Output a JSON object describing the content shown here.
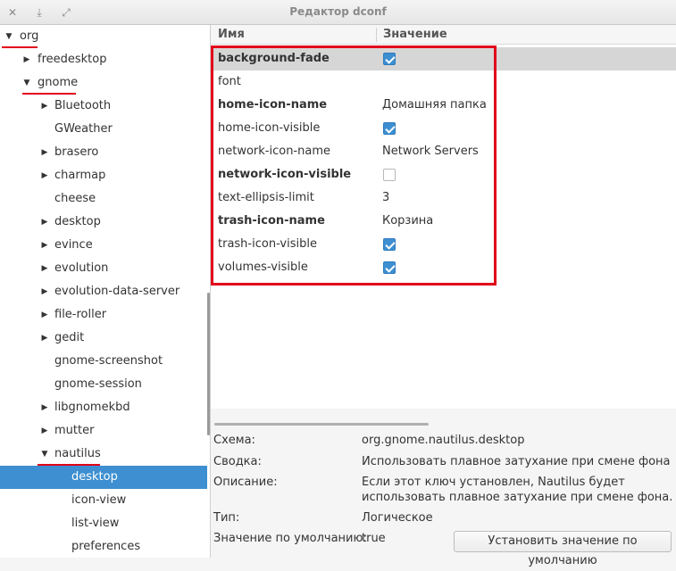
{
  "window": {
    "title": "Редактор dconf",
    "close_glyph": "✕",
    "minimize_glyph": "⤓",
    "maximize_glyph": "⤢"
  },
  "tree": [
    {
      "label": "org",
      "level": 0,
      "expanded": true,
      "has_arrow": true
    },
    {
      "label": "freedesktop",
      "level": 1,
      "expanded": false,
      "has_arrow": true
    },
    {
      "label": "gnome",
      "level": 1,
      "expanded": true,
      "has_arrow": true
    },
    {
      "label": "Bluetooth",
      "level": 2,
      "expanded": false,
      "has_arrow": true
    },
    {
      "label": "GWeather",
      "level": 2,
      "expanded": false,
      "has_arrow": false
    },
    {
      "label": "brasero",
      "level": 2,
      "expanded": false,
      "has_arrow": true
    },
    {
      "label": "charmap",
      "level": 2,
      "expanded": false,
      "has_arrow": true
    },
    {
      "label": "cheese",
      "level": 2,
      "expanded": false,
      "has_arrow": false
    },
    {
      "label": "desktop",
      "level": 2,
      "expanded": false,
      "has_arrow": true
    },
    {
      "label": "evince",
      "level": 2,
      "expanded": false,
      "has_arrow": true
    },
    {
      "label": "evolution",
      "level": 2,
      "expanded": false,
      "has_arrow": true
    },
    {
      "label": "evolution-data-server",
      "level": 2,
      "expanded": false,
      "has_arrow": true
    },
    {
      "label": "file-roller",
      "level": 2,
      "expanded": false,
      "has_arrow": true
    },
    {
      "label": "gedit",
      "level": 2,
      "expanded": false,
      "has_arrow": true
    },
    {
      "label": "gnome-screenshot",
      "level": 2,
      "expanded": false,
      "has_arrow": false
    },
    {
      "label": "gnome-session",
      "level": 2,
      "expanded": false,
      "has_arrow": false
    },
    {
      "label": "libgnomekbd",
      "level": 2,
      "expanded": false,
      "has_arrow": true
    },
    {
      "label": "mutter",
      "level": 2,
      "expanded": false,
      "has_arrow": true
    },
    {
      "label": "nautilus",
      "level": 2,
      "expanded": true,
      "has_arrow": true
    },
    {
      "label": "desktop",
      "level": 3,
      "expanded": false,
      "has_arrow": false,
      "selected": true
    },
    {
      "label": "icon-view",
      "level": 3,
      "expanded": false,
      "has_arrow": false
    },
    {
      "label": "list-view",
      "level": 3,
      "expanded": false,
      "has_arrow": false
    },
    {
      "label": "preferences",
      "level": 3,
      "expanded": false,
      "has_arrow": false
    }
  ],
  "table": {
    "col_name": "Имя",
    "col_value": "Значение",
    "rows": [
      {
        "key": "background-fade",
        "bold": true,
        "type": "bool",
        "checked": true,
        "highlight": true
      },
      {
        "key": "font",
        "bold": false,
        "type": "text",
        "value": ""
      },
      {
        "key": "home-icon-name",
        "bold": true,
        "type": "text",
        "value": "Домашняя папка"
      },
      {
        "key": "home-icon-visible",
        "bold": false,
        "type": "bool",
        "checked": true
      },
      {
        "key": "network-icon-name",
        "bold": false,
        "type": "text",
        "value": "Network Servers"
      },
      {
        "key": "network-icon-visible",
        "bold": true,
        "type": "bool",
        "checked": false
      },
      {
        "key": "text-ellipsis-limit",
        "bold": false,
        "type": "text",
        "value": "3"
      },
      {
        "key": "trash-icon-name",
        "bold": true,
        "type": "text",
        "value": "Корзина"
      },
      {
        "key": "trash-icon-visible",
        "bold": false,
        "type": "bool",
        "checked": true
      },
      {
        "key": "volumes-visible",
        "bold": false,
        "type": "bool",
        "checked": true
      }
    ]
  },
  "info": {
    "schema_label": "Схема:",
    "schema_value": "org.gnome.nautilus.desktop",
    "summary_label": "Сводка:",
    "summary_value": "Использовать плавное затухание при смене фона",
    "description_label": "Описание:",
    "description_line1": "Если этот ключ установлен, Nautilus будет",
    "description_line2": "использовать плавное затухание при смене фона.",
    "type_label": "Тип:",
    "type_value": "Логическое",
    "default_label": "Значение по умолчанию:",
    "default_value": "true",
    "reset_button": "Установить значение по умолчанию"
  },
  "colors": {
    "selection": "#3d8fd1",
    "annotation_red": "#e2001a"
  }
}
